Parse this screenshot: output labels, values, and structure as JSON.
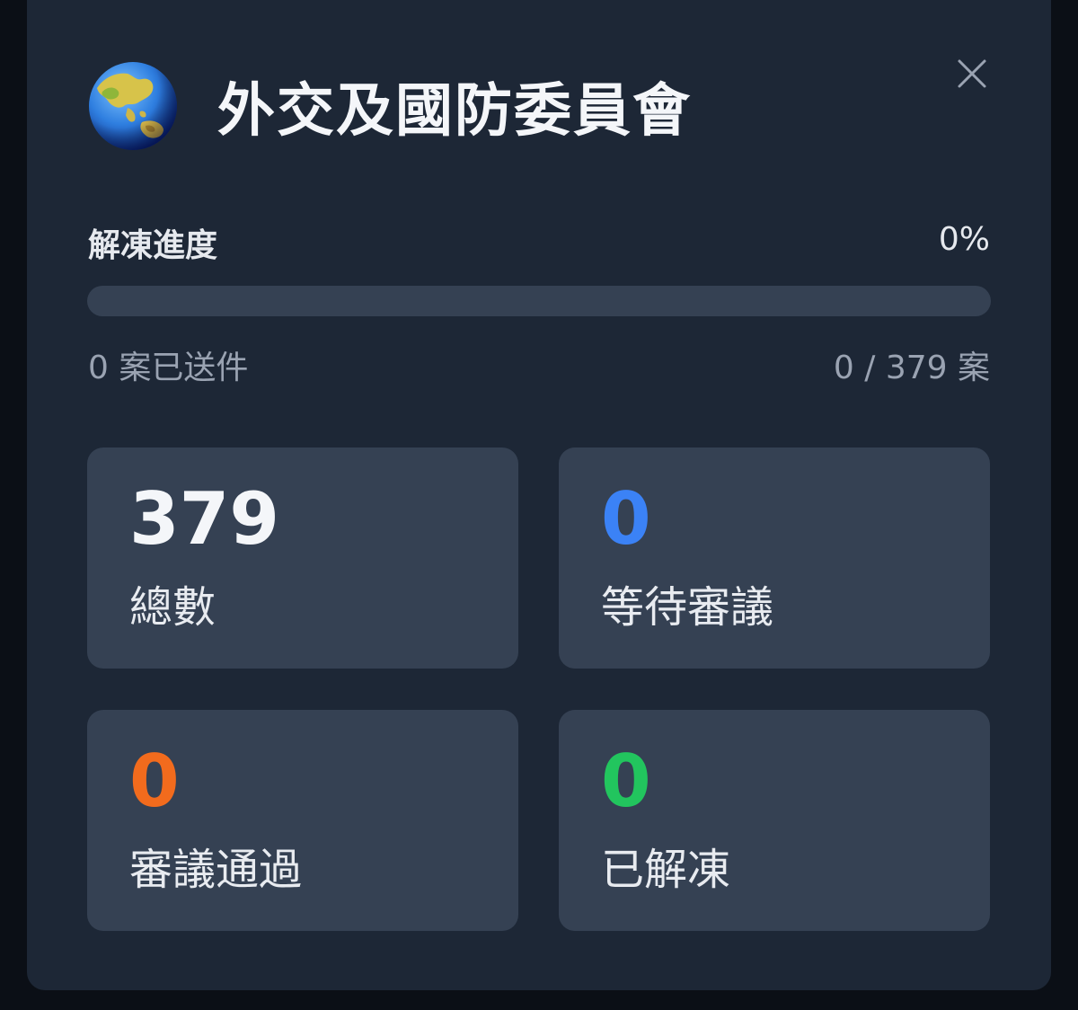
{
  "header": {
    "title": "外交及國防委員會",
    "icon": "globe-asia-australia-icon"
  },
  "progress": {
    "label": "解凍進度",
    "percent_text": "0%",
    "fraction": 0,
    "sent_text": "0 案已送件",
    "ratio_text": "0 / 379 案"
  },
  "cards": {
    "total": {
      "value": "379",
      "label": "總數",
      "color": "#f4f6f9"
    },
    "pending": {
      "value": "0",
      "label": "等待審議",
      "color": "#3b82f6"
    },
    "passed": {
      "value": "0",
      "label": "審議通過",
      "color": "#f26b1d"
    },
    "unfrozen": {
      "value": "0",
      "label": "已解凍",
      "color": "#22c55e"
    }
  },
  "colors": {
    "panel_bg": "#1d2736",
    "card_bg": "#354153",
    "accent_blue": "#3b82f6",
    "accent_orange": "#f26b1d",
    "accent_green": "#22c55e"
  }
}
